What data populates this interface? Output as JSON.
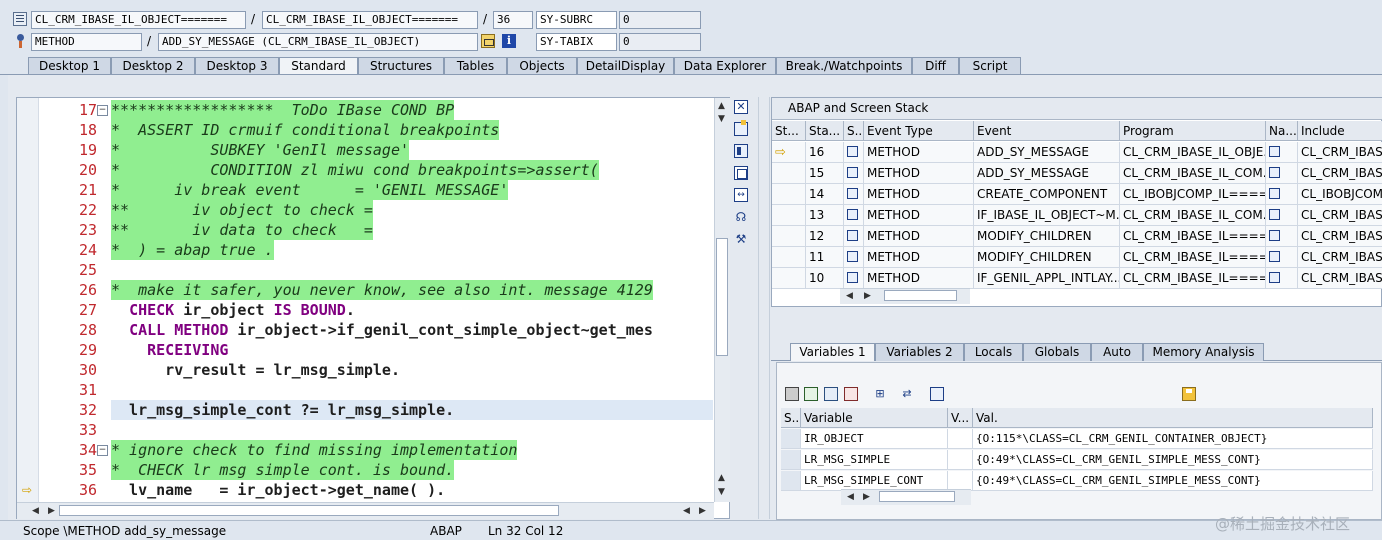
{
  "header": {
    "row1": {
      "program1": "CL_CRM_IBASE_IL_OBJECT=======",
      "program2": "CL_CRM_IBASE_IL_OBJECT=======",
      "line": "36",
      "sy_label": "SY-SUBRC",
      "sy_value": "0"
    },
    "row2": {
      "type": "METHOD",
      "event": "ADD_SY_MESSAGE (CL_CRM_IBASE_IL_OBJECT)",
      "sy_label": "SY-TABIX",
      "sy_value": "0"
    }
  },
  "tabs": [
    "Desktop 1",
    "Desktop 2",
    "Desktop 3",
    "Standard",
    "Structures",
    "Tables",
    "Objects",
    "DetailDisplay",
    "Data Explorer",
    "Break./Watchpoints",
    "Diff",
    "Script"
  ],
  "code": {
    "lines": [
      {
        "n": "17",
        "text": "******************  ToDo IBase COND BP"
      },
      {
        "n": "18",
        "text": "*  ASSERT ID crmuif conditional breakpoints"
      },
      {
        "n": "19",
        "text": "*          SUBKEY 'GenIl message'"
      },
      {
        "n": "20",
        "text": "*          CONDITION zl miwu cond breakpoints=>assert("
      },
      {
        "n": "21",
        "text": "*      iv break event      = 'GENIL MESSAGE'"
      },
      {
        "n": "22",
        "text": "**       iv object to check ="
      },
      {
        "n": "23",
        "text": "**       iv data to check   ="
      },
      {
        "n": "24",
        "text": "*  ) = abap true ."
      },
      {
        "n": "25",
        "text": ""
      },
      {
        "n": "26",
        "text": "*  make it safer, you never know, see also int. message 4129"
      },
      {
        "n": "27",
        "text": "  CHECK ir_object IS BOUND."
      },
      {
        "n": "28",
        "text": "  CALL METHOD ir_object->if_genil_cont_simple_object~get_mes"
      },
      {
        "n": "29",
        "text": "    RECEIVING"
      },
      {
        "n": "30",
        "text": "      rv_result = lr_msg_simple."
      },
      {
        "n": "31",
        "text": ""
      },
      {
        "n": "32",
        "text": "  lr_msg_simple_cont ?= lr_msg_simple."
      },
      {
        "n": "33",
        "text": ""
      },
      {
        "n": "34",
        "text": "* ignore check to find missing implementation"
      },
      {
        "n": "35",
        "text": "*  CHECK lr msg simple cont. is bound."
      },
      {
        "n": "36",
        "text": "  lv_name   = ir_object->get_name( )."
      }
    ]
  },
  "status": {
    "scope": "Scope \\METHOD add_sy_message",
    "lang": "ABAP",
    "position": "Ln  32 Col  12"
  },
  "stack": {
    "title": "ABAP and Screen Stack",
    "columns": [
      "St...",
      "Sta...",
      "S...",
      "Event Type",
      "Event",
      "Program",
      "Na...",
      "Include"
    ],
    "rows": [
      {
        "level": "16",
        "type": "METHOD",
        "event": "ADD_SY_MESSAGE",
        "program": "CL_CRM_IBASE_IL_OBJE...",
        "include": "CL_CRM_IBASE_"
      },
      {
        "level": "15",
        "type": "METHOD",
        "event": "ADD_SY_MESSAGE",
        "program": "CL_CRM_IBASE_IL_COM...",
        "include": "CL_CRM_IBASE_"
      },
      {
        "level": "14",
        "type": "METHOD",
        "event": "CREATE_COMPONENT",
        "program": "CL_IBOBJCOMP_IL====...",
        "include": "CL_IBOBJCOMP"
      },
      {
        "level": "13",
        "type": "METHOD",
        "event": "IF_IBASE_IL_OBJECT~M...",
        "program": "CL_CRM_IBASE_IL_COM...",
        "include": "CL_CRM_IBASE_"
      },
      {
        "level": "12",
        "type": "METHOD",
        "event": "MODIFY_CHILDREN",
        "program": "CL_CRM_IBASE_IL====...",
        "include": "CL_CRM_IBASE_"
      },
      {
        "level": "11",
        "type": "METHOD",
        "event": "MODIFY_CHILDREN",
        "program": "CL_CRM_IBASE_IL====...",
        "include": "CL_CRM_IBASE_"
      },
      {
        "level": "10",
        "type": "METHOD",
        "event": "IF_GENIL_APPL_INTLAY...",
        "program": "CL_CRM_IBASE_IL====...",
        "include": "CL_CRM_IBASE_"
      }
    ]
  },
  "vartabs": [
    "Variables 1",
    "Variables 2",
    "Locals",
    "Globals",
    "Auto",
    "Memory Analysis"
  ],
  "variables": {
    "columns": [
      "S...",
      "Variable",
      "V...",
      "Val."
    ],
    "rows": [
      {
        "name": "IR_OBJECT",
        "value": "{O:115*\\CLASS=CL_CRM_GENIL_CONTAINER_OBJECT}"
      },
      {
        "name": "LR_MSG_SIMPLE",
        "value": "{O:49*\\CLASS=CL_CRM_GENIL_SIMPLE_MESS_CONT}"
      },
      {
        "name": "LR_MSG_SIMPLE_CONT",
        "value": "{O:49*\\CLASS=CL_CRM_GENIL_SIMPLE_MESS_CONT}"
      }
    ]
  },
  "watermark": "@稀土掘金技术社区",
  "colors": {
    "comment_bg": "#90ee90",
    "keyword": "#800080",
    "line_number": "#c0282d"
  }
}
